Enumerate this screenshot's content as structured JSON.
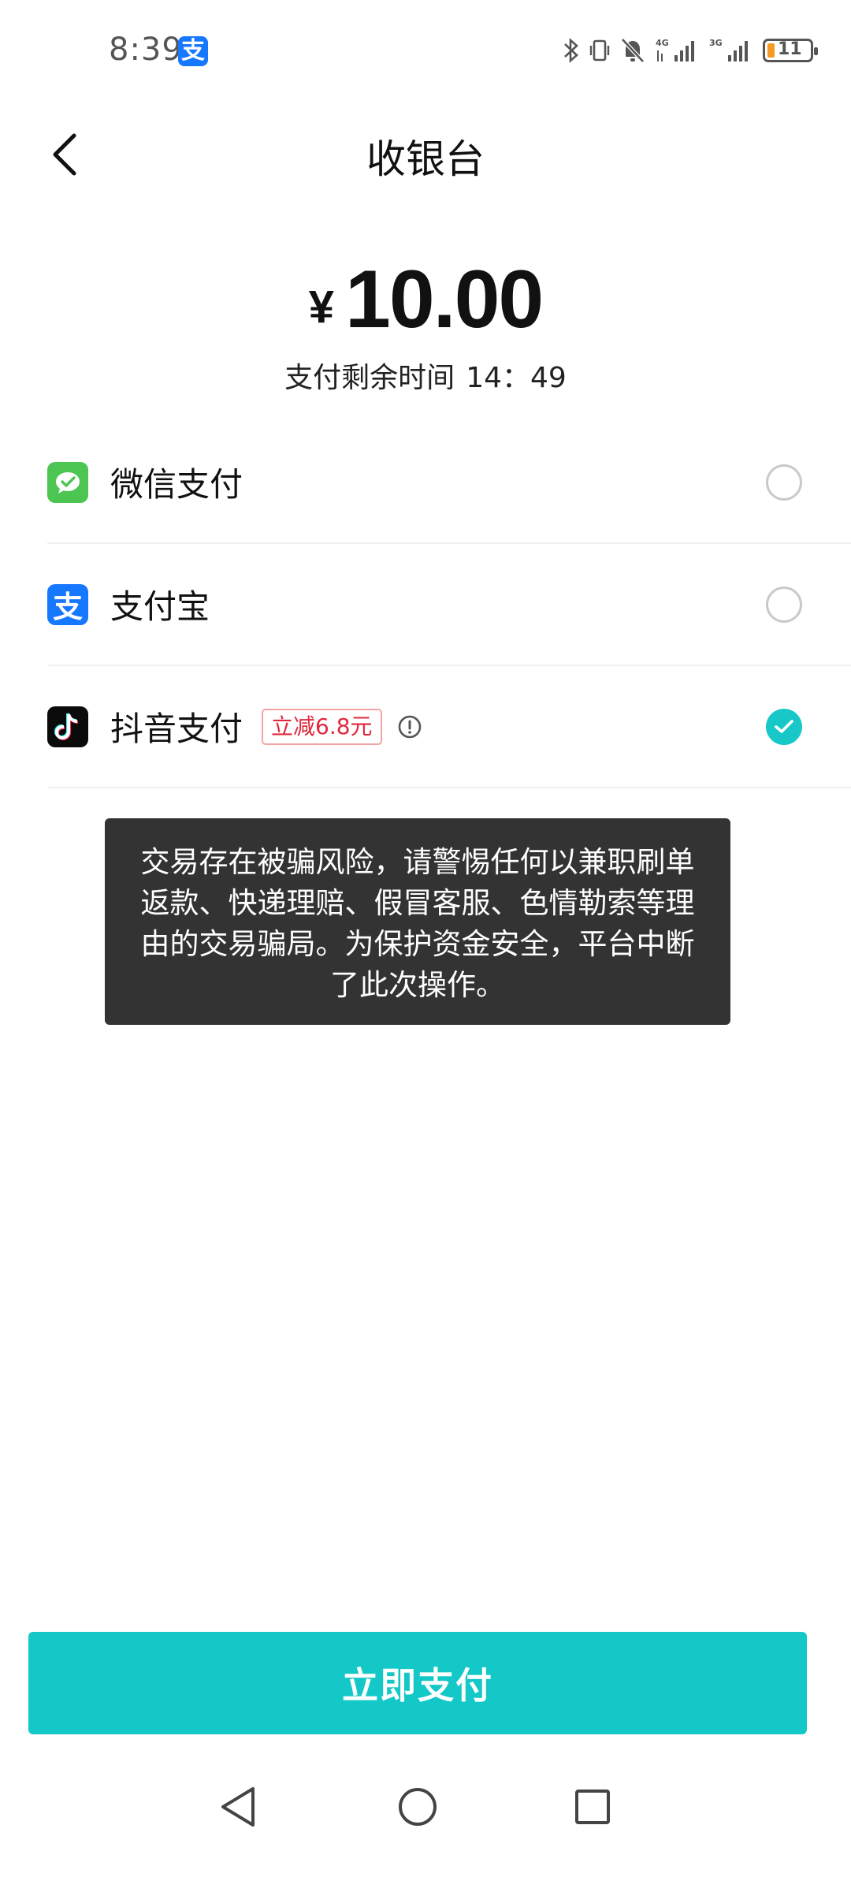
{
  "status_bar": {
    "time": "8:39",
    "app_badge": "支",
    "network_1": "4G",
    "network_2": "3G",
    "battery_level": "11"
  },
  "header": {
    "title": "收银台",
    "back_icon": "chevron-left-icon"
  },
  "amount": {
    "currency_symbol": "¥",
    "value": "10.00"
  },
  "countdown": {
    "label": "支付剩余时间",
    "time": "14：49"
  },
  "payment_methods": [
    {
      "label": "微信支付",
      "icon": "wechat-pay-icon",
      "selected": false
    },
    {
      "label": "支付宝",
      "icon": "alipay-icon",
      "icon_text": "支",
      "selected": false
    },
    {
      "label": "抖音支付",
      "icon": "douyin-pay-icon",
      "badge": "立减6.8元",
      "selected": true
    }
  ],
  "toast": {
    "message": "交易存在被骗风险，请警惕任何以兼职刷单返款、快递理赔、假冒客服、色情勒索等理由的交易骗局。为保护资金安全，平台中断了此次操作。"
  },
  "pay_button": {
    "label": "立即支付"
  },
  "colors": {
    "accent": "#14c8c8",
    "wechat": "#4cc552",
    "alipay": "#1677ff",
    "badge_red": "#e0283c",
    "toast_bg": "#333333"
  }
}
